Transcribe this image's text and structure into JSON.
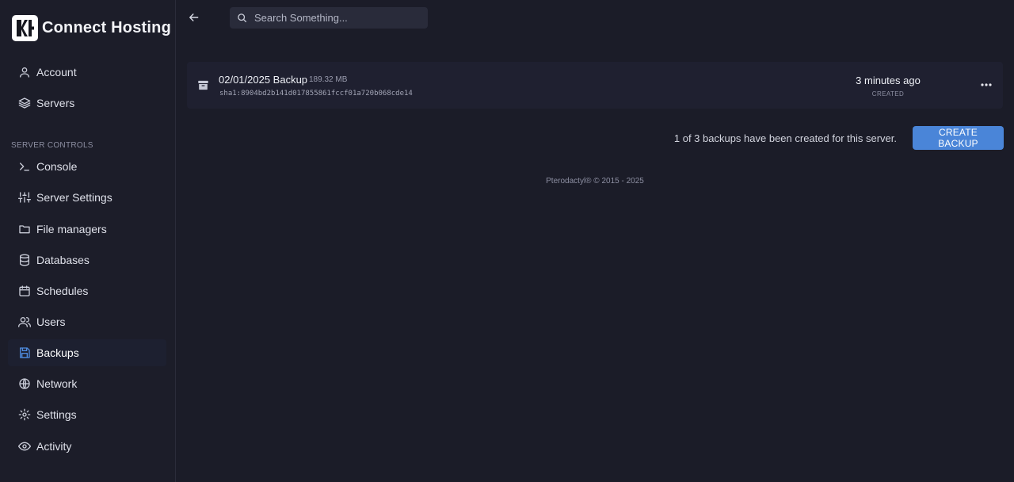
{
  "brand": {
    "name": "Connect Hosting"
  },
  "sidebar": {
    "top_items": [
      {
        "label": "Account",
        "icon": "user-icon"
      },
      {
        "label": "Servers",
        "icon": "layers-icon"
      }
    ],
    "section_label": "SERVER CONTROLS",
    "items": [
      {
        "label": "Console",
        "icon": "terminal-icon"
      },
      {
        "label": "Server Settings",
        "icon": "sliders-icon"
      },
      {
        "label": "File managers",
        "icon": "folder-icon"
      },
      {
        "label": "Databases",
        "icon": "database-icon"
      },
      {
        "label": "Schedules",
        "icon": "calendar-icon"
      },
      {
        "label": "Users",
        "icon": "users-icon"
      },
      {
        "label": "Backups",
        "icon": "save-icon",
        "active": true
      },
      {
        "label": "Network",
        "icon": "globe-icon"
      },
      {
        "label": "Settings",
        "icon": "gear-icon"
      },
      {
        "label": "Activity",
        "icon": "eye-icon"
      }
    ]
  },
  "search": {
    "placeholder": "Search Something..."
  },
  "backup": {
    "name": "02/01/2025 Backup",
    "size": "189.32 MB",
    "hash": "sha1:8904bd2b141d017855861fccf01a720b068cde14",
    "time": "3 minutes ago",
    "created_label": "CREATED"
  },
  "backup_count_text": "1 of 3 backups have been created for this server.",
  "create_button_label": "CREATE BACKUP",
  "footer": "Pterodactyl® © 2015 - 2025",
  "colors": {
    "accent": "#4a85d8",
    "background": "#1b1c28",
    "card": "#1f2030"
  }
}
